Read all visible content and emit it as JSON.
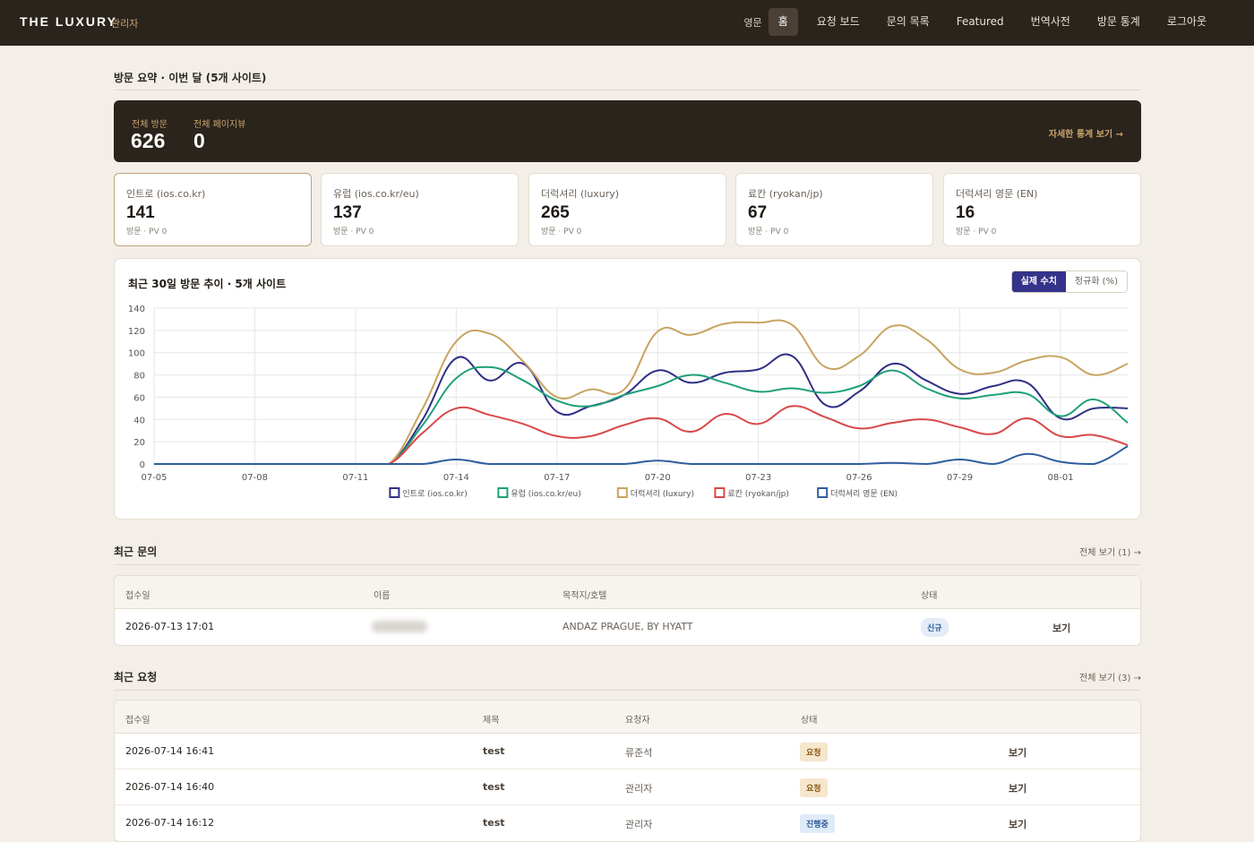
{
  "header": {
    "brand": "THE LUXURY",
    "brand_sub": "관리자",
    "lang": "영문",
    "nav": [
      "홈",
      "요청 보드",
      "문의 목록",
      "Featured",
      "번역사전",
      "방문 통계",
      "로그아웃"
    ]
  },
  "summary_section": {
    "title": "방문 요약 · 이번 달 (5개 사이트)",
    "total_visits_label": "전체 방문",
    "total_visits": "626",
    "total_pv_label": "전체 페이지뷰",
    "total_pv": "0",
    "detail_link": "자세한 통계 보기 →"
  },
  "sites": [
    {
      "name": "인트로 (ios.co.kr)",
      "visits": "141",
      "sub": "방문 · PV 0"
    },
    {
      "name": "유럽 (ios.co.kr/eu)",
      "visits": "137",
      "sub": "방문 · PV 0"
    },
    {
      "name": "더럭셔리 (luxury)",
      "visits": "265",
      "sub": "방문 · PV 0"
    },
    {
      "name": "료칸 (ryokan/jp)",
      "visits": "67",
      "sub": "방문 · PV 0"
    },
    {
      "name": "더럭셔리 영문 (EN)",
      "visits": "16",
      "sub": "방문 · PV 0"
    }
  ],
  "chart_section": {
    "title": "최근 30일 방문 추이 · 5개 사이트",
    "toggle_actual": "실제 수치",
    "toggle_normalized": "정규화 (%)"
  },
  "chart_data": {
    "type": "line",
    "x": [
      "07-05",
      "07-06",
      "07-07",
      "07-08",
      "07-09",
      "07-10",
      "07-11",
      "07-12",
      "07-13",
      "07-14",
      "07-15",
      "07-16",
      "07-17",
      "07-18",
      "07-19",
      "07-20",
      "07-21",
      "07-22",
      "07-23",
      "07-24",
      "07-25",
      "07-26",
      "07-27",
      "07-28",
      "07-29",
      "07-30",
      "07-31",
      "08-01",
      "08-02",
      "08-03"
    ],
    "x_ticks": [
      "07-05",
      "07-08",
      "07-11",
      "07-14",
      "07-17",
      "07-20",
      "07-23",
      "07-26",
      "07-29",
      "08-01"
    ],
    "ylim": [
      0,
      140
    ],
    "y_ticks": [
      0,
      20,
      40,
      60,
      80,
      100,
      120,
      140
    ],
    "grid": true,
    "legend_position": "bottom",
    "series": [
      {
        "name": "인트로 (ios.co.kr)",
        "color": "#2f2f86",
        "values": [
          0,
          0,
          0,
          0,
          0,
          0,
          0,
          0,
          40,
          95,
          75,
          90,
          47,
          52,
          62,
          84,
          73,
          82,
          85,
          97,
          53,
          65,
          90,
          75,
          63,
          70,
          73,
          41,
          50,
          50
        ]
      },
      {
        "name": "유럽 (ios.co.kr/eu)",
        "color": "#1fa07a",
        "values": [
          0,
          0,
          0,
          0,
          0,
          0,
          0,
          0,
          35,
          77,
          87,
          75,
          57,
          52,
          62,
          70,
          80,
          73,
          65,
          68,
          64,
          70,
          84,
          68,
          59,
          62,
          63,
          43,
          58,
          37
        ]
      },
      {
        "name": "더럭셔리 (luxury)",
        "color": "#c8a45f",
        "values": [
          0,
          0,
          0,
          0,
          0,
          0,
          0,
          0,
          50,
          110,
          117,
          92,
          60,
          67,
          67,
          119,
          116,
          126,
          127,
          125,
          87,
          97,
          124,
          112,
          85,
          82,
          93,
          96,
          80,
          90
        ]
      },
      {
        "name": "료칸 (ryokan/jp)",
        "color": "#d94848",
        "values": [
          0,
          0,
          0,
          0,
          0,
          0,
          0,
          0,
          28,
          50,
          44,
          36,
          25,
          25,
          35,
          41,
          29,
          45,
          36,
          52,
          42,
          32,
          37,
          40,
          33,
          27,
          41,
          25,
          26,
          17
        ]
      },
      {
        "name": "더럭셔리 영문 (EN)",
        "color": "#2f5d9e",
        "values": [
          0,
          0,
          0,
          0,
          0,
          0,
          0,
          0,
          0,
          4,
          0,
          0,
          0,
          0,
          0,
          3,
          0,
          0,
          0,
          0,
          0,
          0,
          1,
          0,
          4,
          0,
          9,
          2,
          0,
          16
        ]
      }
    ]
  },
  "inquiries": {
    "title": "최근 문의",
    "link": "전체 보기 (1) →",
    "columns": [
      "접수일",
      "이름",
      "목적지/호텔",
      "상태"
    ],
    "rows": [
      {
        "date": "2026-07-13 17:01",
        "hotel": "ANDAZ PRAGUE, BY HYATT",
        "status": "신규",
        "action": "보기"
      }
    ]
  },
  "requests": {
    "title": "최근 요청",
    "link": "전체 보기 (3) →",
    "columns": [
      "접수일",
      "제목",
      "요청자",
      "상태"
    ],
    "rows": [
      {
        "date": "2026-07-14 16:41",
        "title": "test",
        "requester": "류준석",
        "status": "요청",
        "action": "보기"
      },
      {
        "date": "2026-07-14 16:40",
        "title": "test",
        "requester": "관리자",
        "status": "요청",
        "action": "보기"
      },
      {
        "date": "2026-07-14 16:12",
        "title": "test",
        "requester": "관리자",
        "status": "진행중",
        "action": "보기"
      }
    ]
  }
}
